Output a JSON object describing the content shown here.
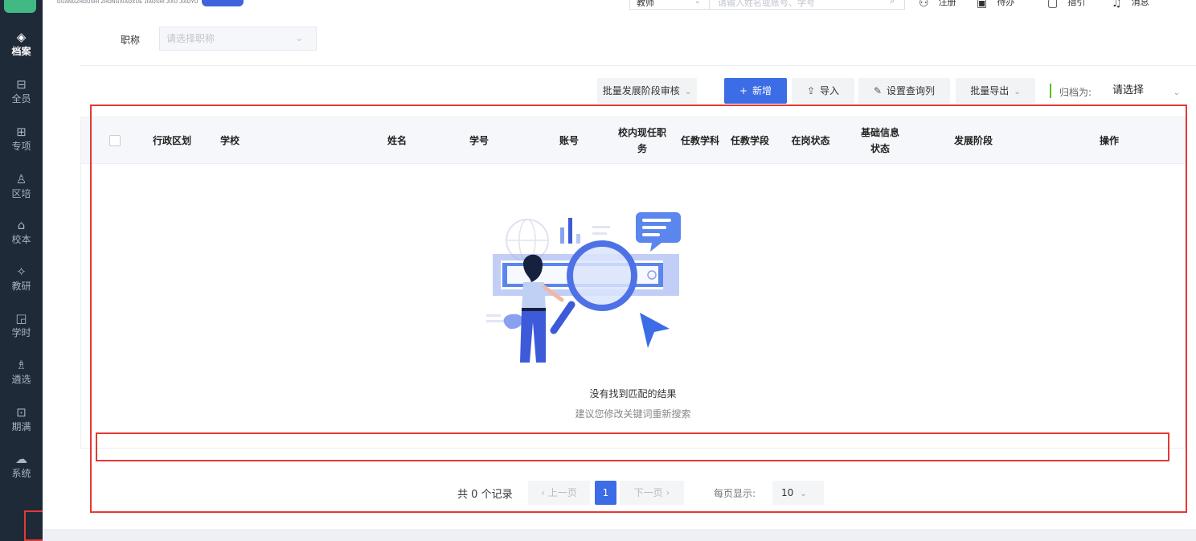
{
  "header": {
    "brand_subtitle": "GUANGZHOUSHI ZHONGXIAOXUE JIAOSHI JIXU JIAOYU",
    "search_type": "教师",
    "search_placeholder": "请输入姓名或账号、学号",
    "tools": [
      {
        "icon": "user-icon",
        "glyph": "⚇",
        "label": "注册"
      },
      {
        "icon": "calendar-icon",
        "glyph": "▣",
        "label": "待办"
      },
      {
        "icon": "file-icon",
        "glyph": "▢",
        "label": "指引"
      },
      {
        "icon": "bell-icon",
        "glyph": "♫",
        "label": "消息"
      }
    ]
  },
  "sidebar": {
    "items": [
      {
        "label": "档案",
        "icon": "layers-icon",
        "glyph": "◈",
        "active": true
      },
      {
        "label": "全员",
        "icon": "book-icon",
        "glyph": "⊟",
        "active": false
      },
      {
        "label": "专项",
        "icon": "briefcase-icon",
        "glyph": "⊞",
        "active": false
      },
      {
        "label": "区培",
        "icon": "person-icon",
        "glyph": "♙",
        "active": false
      },
      {
        "label": "校本",
        "icon": "building-icon",
        "glyph": "⌂",
        "active": false
      },
      {
        "label": "教研",
        "icon": "knot-icon",
        "glyph": "✧",
        "active": false
      },
      {
        "label": "学时",
        "icon": "chart-icon",
        "glyph": "◲",
        "active": false
      },
      {
        "label": "遴选",
        "icon": "user-select-icon",
        "glyph": "♗",
        "active": false
      },
      {
        "label": "期满",
        "icon": "doc-search-icon",
        "glyph": "⊡",
        "active": false
      },
      {
        "label": "系统",
        "icon": "cloud-icon",
        "glyph": "☁",
        "active": false
      }
    ],
    "collapse_glyph": "☰"
  },
  "filter": {
    "title_label": "职称",
    "title_placeholder": "请选择职称"
  },
  "toolbar": {
    "batch_review": "批量发展阶段审核",
    "add": "新增",
    "import": "导入",
    "set_columns": "设置查询列",
    "batch_export": "批量导出",
    "archive_label": "归档为:",
    "archive_value": "请选择"
  },
  "table": {
    "headers": [
      "行政区划",
      "学校",
      "姓名",
      "学号",
      "账号",
      "校内现任职务",
      "任教学科",
      "任教学段",
      "在岗状态",
      "基础信息状态",
      "发展阶段",
      "操作"
    ],
    "empty_title": "没有找到匹配的结果",
    "empty_subtitle": "建议您修改关键词重新搜索"
  },
  "pagination": {
    "total_prefix": "共",
    "total_count": "0",
    "total_suffix": "个记录",
    "prev": "上一页",
    "current_page": "1",
    "next": "下一页",
    "page_size_label": "每页显示:",
    "page_size": "10"
  },
  "colors": {
    "primary": "#3d6ce7",
    "sidebar_bg": "#1f2a38",
    "annotation_red": "#e53935"
  }
}
